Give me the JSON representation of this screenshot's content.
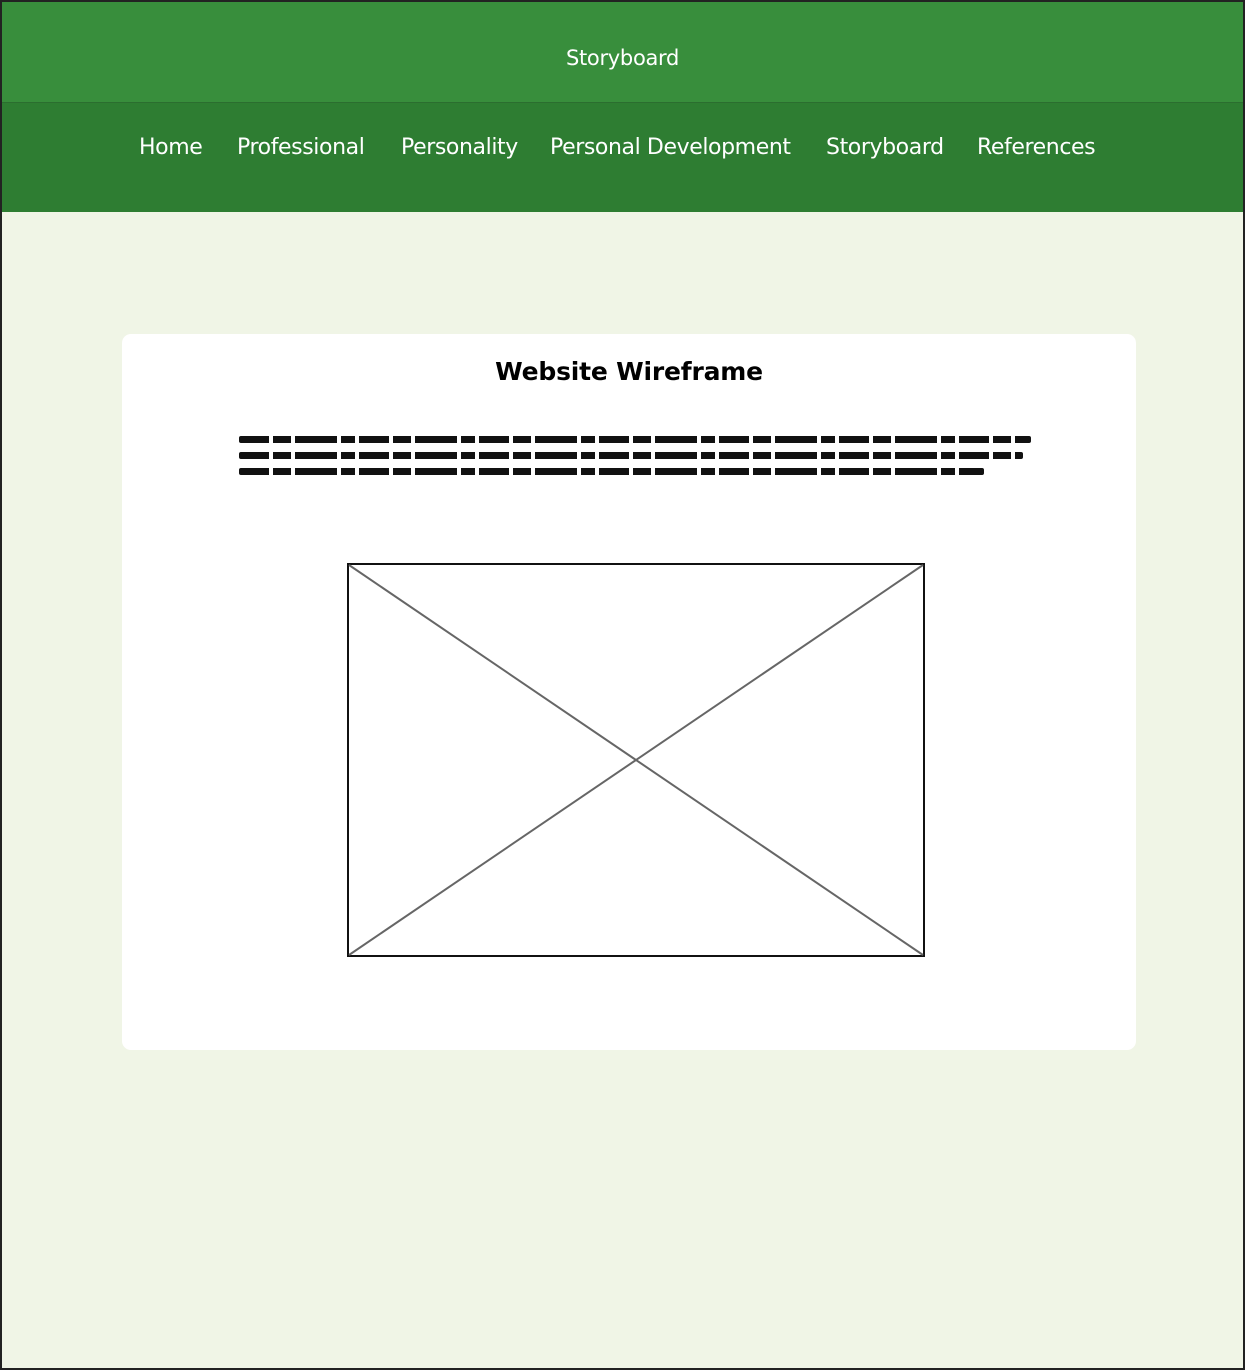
{
  "header": {
    "title": "Storyboard"
  },
  "nav": {
    "items": [
      {
        "label": "Home"
      },
      {
        "label": "Professional"
      },
      {
        "label": "Personality"
      },
      {
        "label": "Personal Development"
      },
      {
        "label": "Storyboard"
      },
      {
        "label": "References"
      }
    ]
  },
  "card": {
    "title": "Website Wireframe",
    "image_placeholder_icon": "image-placeholder-icon"
  },
  "colors": {
    "title_bar": "#388e3c",
    "nav_bar": "#2e7d32",
    "page_bg": "#f0f5e6",
    "card_bg": "#ffffff"
  }
}
